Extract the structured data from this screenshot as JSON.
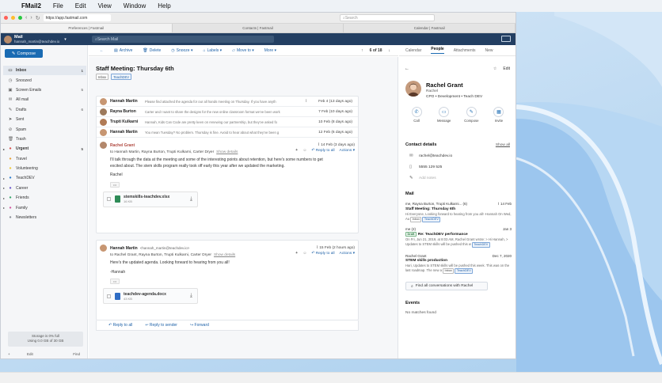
{
  "menubar": {
    "app": "FMail2",
    "items": [
      "File",
      "Edit",
      "View",
      "Window",
      "Help"
    ]
  },
  "browser": {
    "url": "https://app.fastmail.com",
    "search_placeholder": "Search",
    "tabs": [
      "Preferences | Fastmail",
      "Contacts | Fastmail",
      "Calendar | Fastmail"
    ]
  },
  "account": {
    "name": "Mail",
    "email": "hannah_martin@teachdev.io",
    "search_placeholder": "Search Mail"
  },
  "sidebar": {
    "compose": "Compose",
    "items": [
      {
        "label": "Inbox",
        "count": "1",
        "icon": "inbox-icon"
      },
      {
        "label": "Snoozed",
        "count": "",
        "icon": "clock-icon"
      },
      {
        "label": "Screen Emails",
        "count": "5",
        "icon": "screen-icon"
      },
      {
        "label": "All mail",
        "count": "",
        "icon": "mail-icon"
      },
      {
        "label": "Drafts",
        "count": "6",
        "icon": "draft-icon"
      },
      {
        "label": "Sent",
        "count": "",
        "icon": "send-icon"
      },
      {
        "label": "Spam",
        "count": "",
        "icon": "spam-icon"
      },
      {
        "label": "Trash",
        "count": "",
        "icon": "trash-icon"
      },
      {
        "label": "Urgent",
        "count": "5",
        "icon": "tag-icon"
      },
      {
        "label": "Travel",
        "count": "",
        "icon": "tag-icon"
      },
      {
        "label": "Volunteering",
        "count": "",
        "icon": "tag-icon"
      },
      {
        "label": "TeachDEV",
        "count": "",
        "icon": "tag-icon"
      },
      {
        "label": "Career",
        "count": "",
        "icon": "tag-icon"
      },
      {
        "label": "Friends",
        "count": "",
        "icon": "tag-icon"
      },
      {
        "label": "Family",
        "count": "",
        "icon": "tag-icon"
      },
      {
        "label": "Newsletters",
        "count": "",
        "icon": "tag-icon"
      }
    ],
    "storage_line1": "Storage is 0% full",
    "storage_line2": "Using 0.0 GB of 30 GB",
    "footer_left": "Edit",
    "footer_right": "Find"
  },
  "toolbar": {
    "archive": "Archive",
    "delete": "Delete",
    "snooze": "Snooze",
    "labels": "Labels",
    "move": "Move to",
    "more": "More",
    "pager": "6 of 18"
  },
  "thread": {
    "subject": "Staff Meeting: Thursday 6th",
    "tags": [
      "Inbox",
      "TeachDEV"
    ],
    "collapsed": [
      {
        "sender": "Hannah Martin",
        "snippet": "Please find attached the agenda for our all hands meeting on Thursday. If you have anyth",
        "date": "Feb 4 (13 days ago)",
        "color": "#c79672"
      },
      {
        "sender": "Rayna Burton",
        "snippet": "Carter and I want to share the designs for the new online classroom format we've been work",
        "date": "7 Feb (10 days ago)",
        "color": "#9d7a5c"
      },
      {
        "sender": "Trupti Kulkarni",
        "snippet": "Hannah, Kids Can Code are pretty keen on renewing our partnership, but they've asked fo",
        "date": "10 Feb (8 days ago)",
        "color": "#b07a55"
      },
      {
        "sender": "Hannah Martin",
        "snippet": "You mean Tuesday? No problem. Thursday is fine. Avoid to hear about what they've been g",
        "date": "12 Feb (6 days ago)",
        "color": "#c79672"
      }
    ],
    "open": {
      "sender": "Rachel Grant",
      "date": "14 Feb (3 days ago)",
      "to": "to Hannah Martin, Rayna Burton, Trupti Kulkarni, Carter Dryer",
      "show_details": "Show details",
      "reply_all": "Reply to all",
      "actions": "Actions",
      "body": "I'll talk through the data at the meeting and some of the interesting points about retention, but here's some numbers to get excited about. The stem skills program really took off early this year after we updated the marketing.",
      "sign": "Rachel",
      "attachment": {
        "name": "stemskills-teachdev.xlsx",
        "size": "16 KB"
      }
    },
    "open2": {
      "sender": "Hannah Martin",
      "email": "<hannah_martin@teachdev.io>",
      "date": "15 Feb (2 hours ago)",
      "to": "to Rachel Grant, Rayna Burton, Trupti Kulkarni, Carter Dryer",
      "show_details": "Show details",
      "reply_all": "Reply to all",
      "actions": "Actions",
      "body": "Here's the updated agenda. Looking forward to hearing from you all!",
      "sign": "-Hannah",
      "attachment": {
        "name": "teachdev-agenda.docx",
        "size": "43 KB"
      }
    },
    "reply_bar": {
      "reply_all": "Reply to all",
      "reply_sender": "Reply to sender",
      "forward": "Forward"
    }
  },
  "right": {
    "tabs": [
      "Calendar",
      "People",
      "Attachments",
      "New"
    ],
    "active_tab": "People",
    "edit": "Edit",
    "person": {
      "name": "Rachel Grant",
      "nick": "Rachel",
      "role": "CPO • Development • Teach DEV"
    },
    "actions": [
      "Call",
      "Message",
      "Compose",
      "Invite"
    ],
    "contact_title": "Contact details",
    "show_all": "Show all",
    "email": "rachel@teachdev.io",
    "phone": "5555 129 525",
    "notes_placeholder": "Add notes",
    "mail_title": "Mail",
    "mail": [
      {
        "from": "me, Rayna Burton, Trupti Kulkarni... (6)",
        "date": "14 Feb",
        "subject": "Staff Meeting: Thursday 6th",
        "snippet": "Hi Everyone, Looking forward to hearing from you all! -Hannah On Wed, Au",
        "tags": [
          "Inbox",
          "TeachDEV"
        ],
        "draft": ""
      },
      {
        "from": "me (2)",
        "date": "Jan 3",
        "subject": "Re: TeachDEV performance",
        "snippet": "On Fri, Jun 21, 2019, at 8:03 AM, Rachel Grant wrote: > Hi Hannah, > Updates to STEM skills will be pushed this w",
        "tags": [
          "TeachDEV"
        ],
        "draft": "Draft"
      },
      {
        "from": "Rachel Grant",
        "date": "Dec 7, 2020",
        "subject": "STEM skills production",
        "snippet": "Hari, Updates to STEM skills will be pushed this week. This was on the last roadmap. The new a",
        "tags": [
          "Inbox",
          "TeachDEV"
        ],
        "draft": ""
      }
    ],
    "find_all": "Find all conversations with Rachel",
    "events_title": "Events",
    "no_matches": "No matches found"
  }
}
